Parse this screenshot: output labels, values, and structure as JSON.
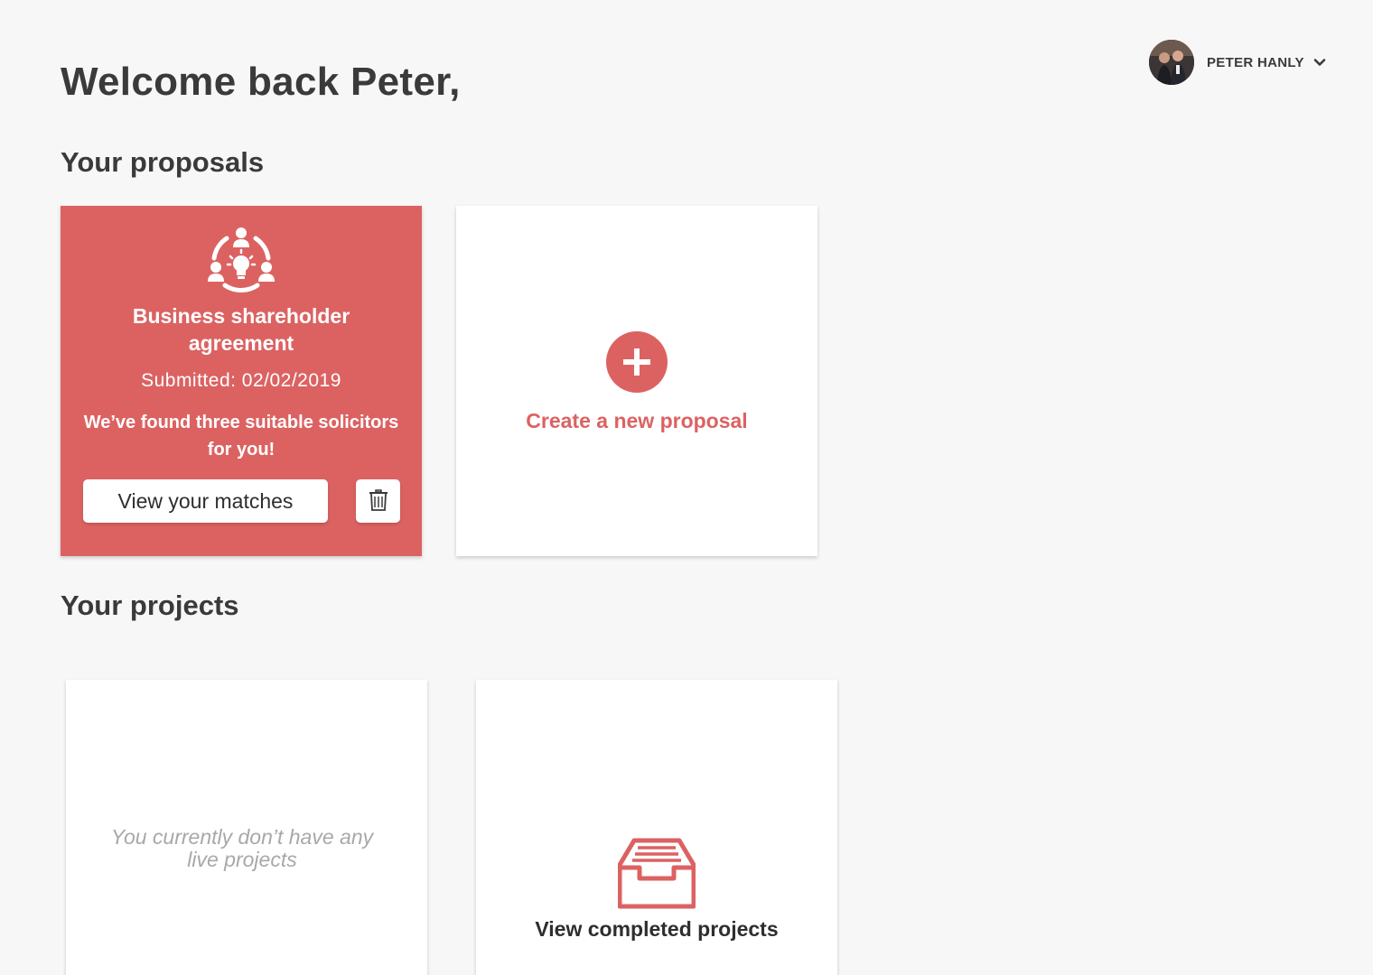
{
  "user": {
    "name": "PETER HANLY"
  },
  "welcome": "Welcome back Peter,",
  "proposals": {
    "section_title": "Your proposals",
    "card": {
      "title": "Business shareholder agreement",
      "submitted": "Submitted: 02/02/2019",
      "message": "We’ve found three suitable solicitors for you!",
      "view_button": "View your matches"
    },
    "new_card": {
      "label": "Create a new proposal"
    }
  },
  "projects": {
    "section_title": "Your projects",
    "empty_message": "You currently don’t have any live projects",
    "completed_label": "View completed projects"
  },
  "colors": {
    "accent": "#dc6262",
    "background": "#f7f7f7",
    "text": "#3a3a3a",
    "muted": "#a8a8a8"
  },
  "icons": {
    "proposal": "team-idea-icon",
    "delete": "trash-icon",
    "add": "plus-icon",
    "completed": "inbox-tray-icon",
    "menu": "chevron-down-icon"
  }
}
